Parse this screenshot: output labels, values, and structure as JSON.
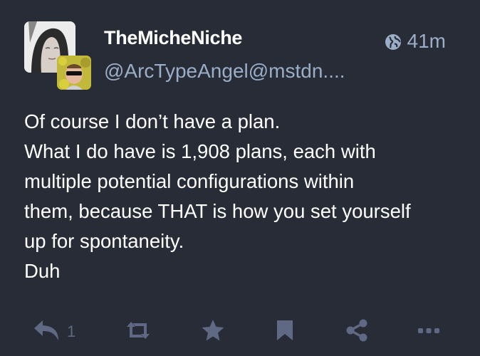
{
  "status": {
    "display_name": "TheMicheNiche",
    "account": "@ArcTypeAngel@mstdn....",
    "time": "41m",
    "visibility_icon": "globe-icon",
    "content_lines": [
      "Of course I don’t have a plan.",
      "What I do have is 1,908 plans, each with",
      "multiple potential configurations within",
      "them, because THAT is how you set yourself",
      "up for spontaneity.",
      "Duh"
    ]
  },
  "actions": {
    "reply_count": "1",
    "reply_icon": "reply-icon",
    "boost_icon": "boost-icon",
    "favourite_icon": "star-icon",
    "bookmark_icon": "bookmark-icon",
    "share_icon": "share-icon",
    "more_icon": "more-icon"
  },
  "colors": {
    "background": "#282c37",
    "secondary_text": "#9baec8",
    "action_icon": "#606984"
  }
}
